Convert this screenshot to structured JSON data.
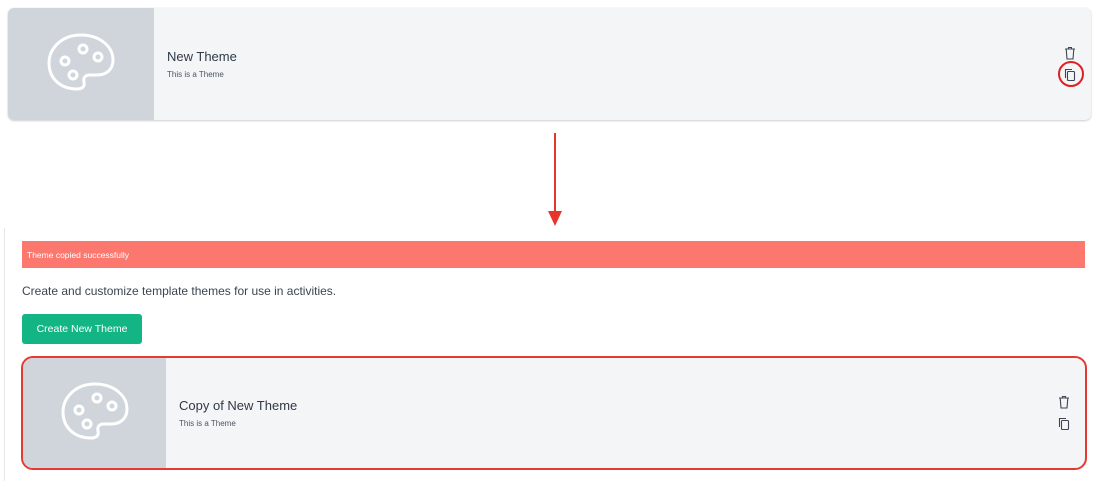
{
  "before_card": {
    "title": "New Theme",
    "description": "This is a Theme",
    "thumbnail_icon": "palette-icon",
    "actions": [
      "trash-icon",
      "copy-icon"
    ]
  },
  "after": {
    "alert_text": "Theme copied successfully",
    "intro_text": "Create and customize template themes for use in activities.",
    "create_button_label": "Create New Theme",
    "card": {
      "title": "Copy of New Theme",
      "description": "This is a Theme",
      "thumbnail_icon": "palette-icon",
      "actions": [
        "trash-icon",
        "copy-icon"
      ]
    }
  },
  "colors": {
    "alert_bg": "#fc776e",
    "button_bg": "#13b584",
    "highlight": "#e53a32",
    "card_bg": "#f4f5f7",
    "thumb_bg": "#d0d4db"
  }
}
